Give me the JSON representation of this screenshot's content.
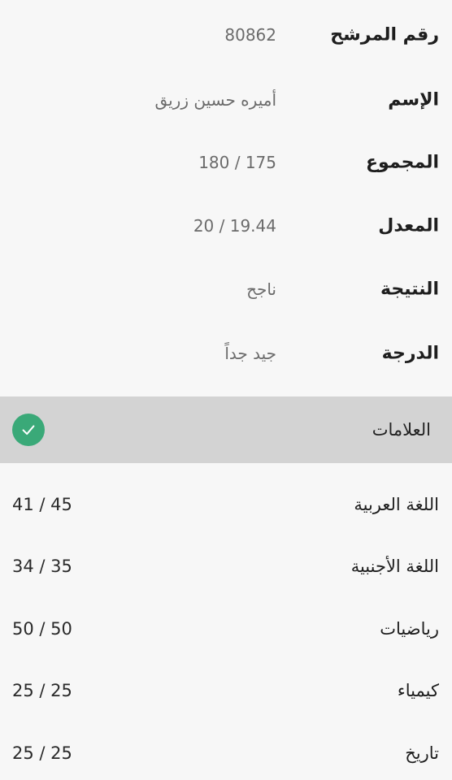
{
  "candidate": {
    "rows": [
      {
        "label": "رقم المرشح",
        "value": "80862"
      },
      {
        "label": "الإسم",
        "value": "أميره حسين زريق"
      },
      {
        "label": "المجموع",
        "value": "180 / 175"
      },
      {
        "label": "المعدل",
        "value": "20 / 19.44"
      },
      {
        "label": "النتيجة",
        "value": "ناجح"
      },
      {
        "label": "الدرجة",
        "value": "جيد جداً"
      }
    ]
  },
  "marks": {
    "title": "العلامات",
    "status_icon": "check-circle-icon",
    "accent_color": "#3aa978",
    "subjects": [
      {
        "name": "اللغة العربية",
        "score": "41 / 45"
      },
      {
        "name": "اللغة الأجنبية",
        "score": "34 / 35"
      },
      {
        "name": "رياضيات",
        "score": "50 / 50"
      },
      {
        "name": "كيمياء",
        "score": "25 / 25"
      },
      {
        "name": "تاريخ",
        "score": "25 / 25"
      }
    ]
  }
}
